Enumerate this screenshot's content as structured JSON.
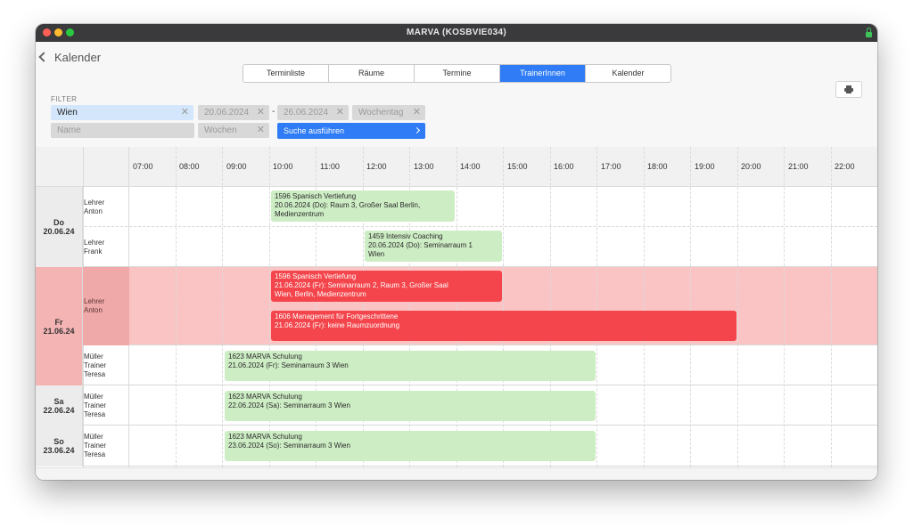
{
  "window": {
    "title": "MARVA (KOSBVIE034)"
  },
  "nav": {
    "back_label": "Kalender"
  },
  "tabs": [
    {
      "label": "Terminliste",
      "active": false
    },
    {
      "label": "Räume",
      "active": false
    },
    {
      "label": "Termine",
      "active": false
    },
    {
      "label": "TrainerInnen",
      "active": true
    },
    {
      "label": "Kalender",
      "active": false
    }
  ],
  "filter": {
    "label": "FILTER",
    "city": "Wien",
    "date_from": "20.06.2024",
    "date_separator": "-",
    "date_to": "26.06.2024",
    "weekday_placeholder": "Wochentag",
    "name_placeholder": "Name",
    "weeks_placeholder": "Wochen",
    "search_button": "Suche ausführen"
  },
  "hours": [
    "07:00",
    "08:00",
    "09:00",
    "10:00",
    "11:00",
    "12:00",
    "13:00",
    "14:00",
    "15:00",
    "16:00",
    "17:00",
    "18:00",
    "19:00",
    "20:00",
    "21:00",
    "22:00"
  ],
  "days": [
    {
      "weekday": "Do",
      "date": "20.06.24"
    },
    {
      "weekday": "Fr",
      "date": "21.06.24"
    },
    {
      "weekday": "Sa",
      "date": "22.06.24"
    },
    {
      "weekday": "So",
      "date": "23.06.24"
    }
  ],
  "trainers": [
    {
      "line1": "Lehrer",
      "line2": "Anton"
    },
    {
      "line1": "Lehrer",
      "line2": "Frank"
    },
    {
      "line1": "Lehrer",
      "line2": "Anton"
    },
    {
      "line1": "Müller",
      "line2": "Trainer",
      "line3": "Teresa"
    },
    {
      "line1": "Müller",
      "line2": "Trainer",
      "line3": "Teresa"
    },
    {
      "line1": "Müller",
      "line2": "Trainer",
      "line3": "Teresa"
    }
  ],
  "events": [
    {
      "line1": "1596 Spanisch Vertiefung",
      "line2": "20.06.2024 (Do): Raum 3, Großer Saal Berlin,",
      "line3": "Medienzentrum",
      "status": "ok"
    },
    {
      "line1": "1459 Intensiv Coaching",
      "line2": "20.06.2024 (Do): Seminarraum 1",
      "line3": "Wien",
      "status": "ok"
    },
    {
      "line1": "1596 Spanisch Vertiefung",
      "line2": "21.06.2024 (Fr): Seminarraum 2, Raum 3, Großer Saal",
      "line3": "Wien, Berlin, Medienzentrum",
      "status": "conflict"
    },
    {
      "line1": "1606 Management für Fortgeschrittene",
      "line2": "21.06.2024 (Fr): keine Raumzuordnung",
      "status": "conflict"
    },
    {
      "line1": "1623 MARVA Schulung",
      "line2": "21.06.2024 (Fr): Seminarraum 3 Wien",
      "status": "ok"
    },
    {
      "line1": "1623 MARVA Schulung",
      "line2": "22.06.2024 (Sa): Seminarraum 3 Wien",
      "status": "ok"
    },
    {
      "line1": "1623 MARVA Schulung",
      "line2": "23.06.2024 (So): Seminarraum 3 Wien",
      "status": "ok"
    }
  ],
  "colors": {
    "accent": "#2f7cf6",
    "conflict": "#f3454b",
    "conflict_band": "#fac4c4",
    "ok_event": "#cdedc4"
  }
}
